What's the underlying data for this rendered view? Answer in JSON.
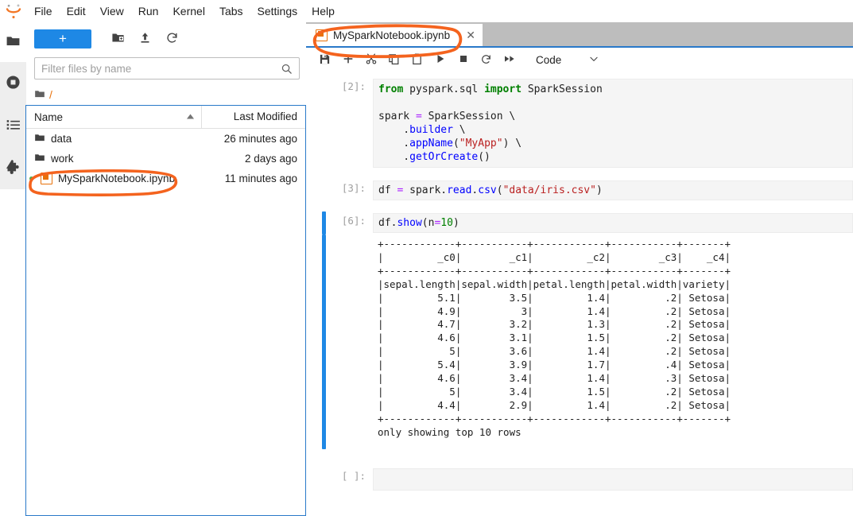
{
  "menubar": {
    "logo": "jupyter-logo",
    "items": [
      "File",
      "Edit",
      "View",
      "Run",
      "Kernel",
      "Tabs",
      "Settings",
      "Help"
    ]
  },
  "activitybar": {
    "items": [
      {
        "name": "file-browser",
        "icon": "folder-icon",
        "active": false
      },
      {
        "name": "running-sessions",
        "icon": "running-icon",
        "active": true
      },
      {
        "name": "commands",
        "icon": "list-icon",
        "active": true
      },
      {
        "name": "extensions",
        "icon": "puzzle-icon",
        "active": true
      }
    ]
  },
  "filebrowser": {
    "new_button_label": "+",
    "toolbar_icons": [
      "new-folder-icon",
      "upload-icon",
      "refresh-icon"
    ],
    "filter": {
      "placeholder": "Filter files by name",
      "value": ""
    },
    "breadcrumb": {
      "home_icon": "folder-icon",
      "path": "/"
    },
    "columns": {
      "name": "Name",
      "last_modified": "Last Modified"
    },
    "sort_direction": "ascending",
    "rows": [
      {
        "icon": "folder-icon",
        "name": "data",
        "modified": "26 minutes ago",
        "running": false
      },
      {
        "icon": "folder-icon",
        "name": "work",
        "modified": "2 days ago",
        "running": false
      },
      {
        "icon": "notebook-icon",
        "name": "MySparkNotebook.ipynb",
        "modified": "11 minutes ago",
        "running": true
      }
    ]
  },
  "main": {
    "tab": {
      "icon": "notebook-icon",
      "title": "MySparkNotebook.ipynb",
      "close_label": "✕"
    },
    "toolbar": {
      "buttons": [
        {
          "name": "save-button",
          "icon": "save-icon"
        },
        {
          "name": "insert-cell-button",
          "icon": "plus-icon"
        },
        {
          "name": "cut-cell-button",
          "icon": "scissors-icon"
        },
        {
          "name": "copy-cell-button",
          "icon": "copy-icon"
        },
        {
          "name": "paste-cell-button",
          "icon": "clipboard-icon"
        },
        {
          "name": "run-cell-button",
          "icon": "play-icon"
        },
        {
          "name": "interrupt-kernel-button",
          "icon": "stop-icon"
        },
        {
          "name": "restart-kernel-button",
          "icon": "restart-icon"
        },
        {
          "name": "restart-run-all-button",
          "icon": "fast-forward-icon"
        }
      ],
      "cell_type": "Code",
      "cell_type_chevron": "chevron-down-icon"
    },
    "cells": [
      {
        "prompt": "[2]:",
        "selected": false,
        "source_lines": [
          [
            {
              "t": "from ",
              "c": "k"
            },
            {
              "t": "pyspark.sql ",
              "c": ""
            },
            {
              "t": "import ",
              "c": "k"
            },
            {
              "t": "SparkSession",
              "c": ""
            }
          ],
          [
            {
              "t": "",
              "c": ""
            }
          ],
          [
            {
              "t": "spark ",
              "c": ""
            },
            {
              "t": "=",
              "c": "op"
            },
            {
              "t": " SparkSession \\",
              "c": ""
            }
          ],
          [
            {
              "t": "    .",
              "c": ""
            },
            {
              "t": "builder",
              "c": "f"
            },
            {
              "t": " \\",
              "c": ""
            }
          ],
          [
            {
              "t": "    .",
              "c": ""
            },
            {
              "t": "appName",
              "c": "f"
            },
            {
              "t": "(",
              "c": ""
            },
            {
              "t": "\"MyApp\"",
              "c": "s"
            },
            {
              "t": ") \\",
              "c": ""
            }
          ],
          [
            {
              "t": "    .",
              "c": ""
            },
            {
              "t": "getOrCreate",
              "c": "f"
            },
            {
              "t": "()",
              "c": ""
            }
          ]
        ]
      },
      {
        "prompt": "[3]:",
        "selected": false,
        "source_lines": [
          [
            {
              "t": "df ",
              "c": ""
            },
            {
              "t": "=",
              "c": "op"
            },
            {
              "t": " spark.",
              "c": ""
            },
            {
              "t": "read",
              "c": "f"
            },
            {
              "t": ".",
              "c": ""
            },
            {
              "t": "csv",
              "c": "f"
            },
            {
              "t": "(",
              "c": ""
            },
            {
              "t": "\"data/iris.csv\"",
              "c": "s"
            },
            {
              "t": ")",
              "c": ""
            }
          ]
        ]
      },
      {
        "prompt": "[6]:",
        "selected": true,
        "source_lines": [
          [
            {
              "t": "df.",
              "c": ""
            },
            {
              "t": "show",
              "c": "f"
            },
            {
              "t": "(",
              "c": ""
            },
            {
              "t": "n",
              "c": ""
            },
            {
              "t": "=",
              "c": "op"
            },
            {
              "t": "10",
              "c": "n"
            },
            {
              "t": ")",
              "c": ""
            }
          ]
        ],
        "output_text": "+------------+-----------+------------+-----------+-------+\n|         _c0|        _c1|         _c2|        _c3|    _c4|\n+------------+-----------+------------+-----------+-------+\n|sepal.length|sepal.width|petal.length|petal.width|variety|\n|         5.1|        3.5|         1.4|         .2| Setosa|\n|         4.9|          3|         1.4|         .2| Setosa|\n|         4.7|        3.2|         1.3|         .2| Setosa|\n|         4.6|        3.1|         1.5|         .2| Setosa|\n|           5|        3.6|         1.4|         .2| Setosa|\n|         5.4|        3.9|         1.7|         .4| Setosa|\n|         4.6|        3.4|         1.4|         .3| Setosa|\n|           5|        3.4|         1.5|         .2| Setosa|\n|         4.4|        2.9|         1.4|         .2| Setosa|\n+------------+-----------+------------+-----------+-------+\nonly showing top 10 rows"
      },
      {
        "prompt": "[ ]:",
        "selected": false,
        "source_lines": [
          [
            {
              "t": "",
              "c": ""
            }
          ]
        ]
      }
    ]
  },
  "annotations": {
    "color": "#f4631e",
    "shapes": [
      {
        "name": "annotation-file-row-highlight",
        "target": "MySparkNotebook.ipynb file row"
      },
      {
        "name": "annotation-tab-highlight",
        "target": "MySparkNotebook.ipynb tab"
      }
    ]
  },
  "table_data": {
    "type": "table",
    "title": "df.show(n=10)",
    "columns": [
      "_c0",
      "_c1",
      "_c2",
      "_c3",
      "_c4"
    ],
    "rows": [
      [
        "sepal.length",
        "sepal.width",
        "petal.length",
        "petal.width",
        "variety"
      ],
      [
        "5.1",
        "3.5",
        "1.4",
        ".2",
        "Setosa"
      ],
      [
        "4.9",
        "3",
        "1.4",
        ".2",
        "Setosa"
      ],
      [
        "4.7",
        "3.2",
        "1.3",
        ".2",
        "Setosa"
      ],
      [
        "4.6",
        "3.1",
        "1.5",
        ".2",
        "Setosa"
      ],
      [
        "5",
        "3.6",
        "1.4",
        ".2",
        "Setosa"
      ],
      [
        "5.4",
        "3.9",
        "1.7",
        ".4",
        "Setosa"
      ],
      [
        "4.6",
        "3.4",
        "1.4",
        ".3",
        "Setosa"
      ],
      [
        "5",
        "3.4",
        "1.5",
        ".2",
        "Setosa"
      ],
      [
        "4.4",
        "2.9",
        "1.4",
        ".2",
        "Setosa"
      ]
    ],
    "footer": "only showing top 10 rows"
  }
}
